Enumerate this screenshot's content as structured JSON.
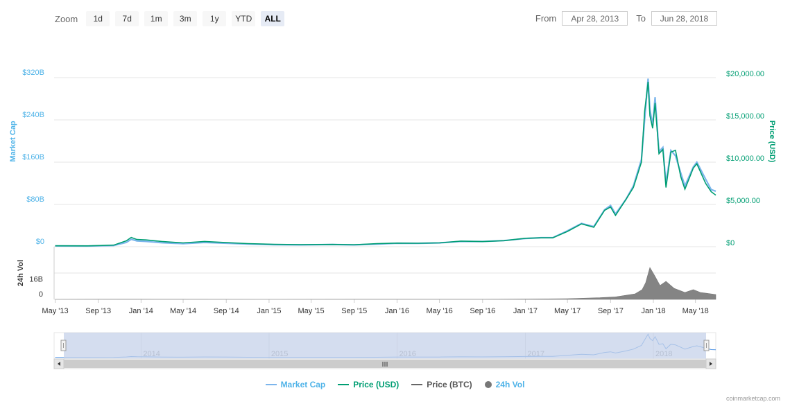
{
  "zoom": {
    "label": "Zoom",
    "buttons": [
      "1d",
      "7d",
      "1m",
      "3m",
      "1y",
      "YTD",
      "ALL"
    ],
    "active": "ALL"
  },
  "range": {
    "from_label": "From",
    "from_value": "Apr 28, 2013",
    "to_label": "To",
    "to_value": "Jun 28, 2018"
  },
  "credits": "coinmarketcap.com",
  "colors": {
    "market_cap": "#7cb5ec",
    "price_usd": "#009e73",
    "price_btc": "#666666",
    "volume": "#777777",
    "navigator_fill": "#c6d2ea"
  },
  "chart_data": {
    "type": "line",
    "x_range": [
      "2013-04-28",
      "2018-06-28"
    ],
    "x_ticks": [
      "May '13",
      "Sep '13",
      "Jan '14",
      "May '14",
      "Sep '14",
      "Jan '15",
      "May '15",
      "Sep '15",
      "Jan '16",
      "May '16",
      "Sep '16",
      "Jan '17",
      "May '17",
      "Sep '17",
      "Jan '18",
      "May '18"
    ],
    "left_axis": {
      "label": "Market Cap",
      "ticks": [
        "$0",
        "$80B",
        "$160B",
        "$240B",
        "$320B"
      ],
      "range": [
        0,
        320
      ]
    },
    "right_axis": {
      "label": "Price (USD)",
      "ticks": [
        "$0",
        "$5,000.00",
        "$10,000.00",
        "$15,000.00",
        "$20,000.00"
      ],
      "range": [
        0,
        20000
      ]
    },
    "volume_axis": {
      "label": "24h Vol",
      "ticks": [
        "0",
        "16B"
      ],
      "range": [
        0,
        24
      ]
    },
    "navigator_years": [
      "2014",
      "2015",
      "2016",
      "2017",
      "2018"
    ],
    "series": [
      {
        "name": "Market Cap",
        "x": [
          "2013-05-01",
          "2013-08-01",
          "2013-10-15",
          "2013-11-20",
          "2013-12-04",
          "2013-12-20",
          "2014-01-15",
          "2014-03-01",
          "2014-05-01",
          "2014-07-01",
          "2014-09-01",
          "2014-11-01",
          "2015-01-15",
          "2015-04-01",
          "2015-07-01",
          "2015-09-01",
          "2015-11-05",
          "2016-01-01",
          "2016-03-01",
          "2016-05-01",
          "2016-07-01",
          "2016-09-01",
          "2016-11-01",
          "2017-01-01",
          "2017-02-15",
          "2017-03-20",
          "2017-05-01",
          "2017-06-10",
          "2017-07-15",
          "2017-08-15",
          "2017-09-01",
          "2017-09-15",
          "2017-10-15",
          "2017-11-05",
          "2017-11-28",
          "2017-12-07",
          "2017-12-17",
          "2017-12-22",
          "2017-12-30",
          "2018-01-06",
          "2018-01-17",
          "2018-01-28",
          "2018-02-06",
          "2018-02-20",
          "2018-03-05",
          "2018-03-20",
          "2018-04-01",
          "2018-04-25",
          "2018-05-05",
          "2018-05-30",
          "2018-06-15",
          "2018-06-28"
        ],
        "values": [
          1.5,
          1.3,
          2.2,
          8,
          14,
          11,
          10,
          7.5,
          5.8,
          8,
          6.5,
          5,
          3.8,
          3.4,
          4,
          3.4,
          4.9,
          6.5,
          6.4,
          7.2,
          10,
          9.8,
          11.5,
          15.5,
          17,
          17,
          30,
          44,
          38,
          70,
          78,
          62,
          90,
          115,
          165,
          240,
          318,
          260,
          230,
          283,
          180,
          188,
          120,
          182,
          172,
          140,
          115,
          151,
          160,
          128,
          108,
          105
        ]
      },
      {
        "name": "Price (USD)",
        "x": [
          "2013-05-01",
          "2013-08-01",
          "2013-10-15",
          "2013-11-20",
          "2013-12-04",
          "2013-12-20",
          "2014-01-15",
          "2014-03-01",
          "2014-05-01",
          "2014-07-01",
          "2014-09-01",
          "2014-11-01",
          "2015-01-15",
          "2015-04-01",
          "2015-07-01",
          "2015-09-01",
          "2015-11-05",
          "2016-01-01",
          "2016-03-01",
          "2016-05-01",
          "2016-07-01",
          "2016-09-01",
          "2016-11-01",
          "2017-01-01",
          "2017-02-15",
          "2017-03-20",
          "2017-05-01",
          "2017-06-10",
          "2017-07-15",
          "2017-08-15",
          "2017-09-01",
          "2017-09-15",
          "2017-10-15",
          "2017-11-05",
          "2017-11-28",
          "2017-12-07",
          "2017-12-17",
          "2017-12-22",
          "2017-12-30",
          "2018-01-06",
          "2018-01-17",
          "2018-01-28",
          "2018-02-06",
          "2018-02-20",
          "2018-03-05",
          "2018-03-20",
          "2018-04-01",
          "2018-04-25",
          "2018-05-05",
          "2018-05-30",
          "2018-06-15",
          "2018-06-28"
        ],
        "values": [
          110,
          100,
          190,
          700,
          1100,
          850,
          800,
          620,
          450,
          620,
          480,
          370,
          280,
          240,
          270,
          230,
          360,
          430,
          410,
          450,
          660,
          610,
          710,
          1000,
          1050,
          1050,
          1800,
          2700,
          2300,
          4300,
          4700,
          3700,
          5600,
          7000,
          10000,
          16000,
          19500,
          15500,
          14000,
          17000,
          11000,
          11500,
          7000,
          11200,
          11400,
          8300,
          6800,
          9300,
          9800,
          7500,
          6500,
          6100
        ]
      },
      {
        "name": "24h Vol",
        "x": [
          "2013-05-01",
          "2013-11-30",
          "2014-02-15",
          "2015-01-15",
          "2016-01-01",
          "2016-09-01",
          "2017-01-05",
          "2017-05-01",
          "2017-08-01",
          "2017-09-15",
          "2017-11-10",
          "2017-11-30",
          "2017-12-10",
          "2017-12-22",
          "2018-01-05",
          "2018-01-20",
          "2018-02-06",
          "2018-03-01",
          "2018-04-01",
          "2018-04-25",
          "2018-05-15",
          "2018-06-28"
        ],
        "values": [
          0.02,
          0.1,
          0.05,
          0.02,
          0.05,
          0.05,
          0.2,
          0.5,
          1.2,
          1.8,
          4,
          7,
          12,
          23,
          17,
          10,
          13,
          8,
          5,
          7,
          5,
          3.5
        ]
      }
    ],
    "legend": [
      {
        "name": "Market Cap",
        "style": "line"
      },
      {
        "name": "Price (USD)",
        "style": "line"
      },
      {
        "name": "Price (BTC)",
        "style": "line"
      },
      {
        "name": "24h Vol",
        "style": "dot"
      }
    ]
  }
}
